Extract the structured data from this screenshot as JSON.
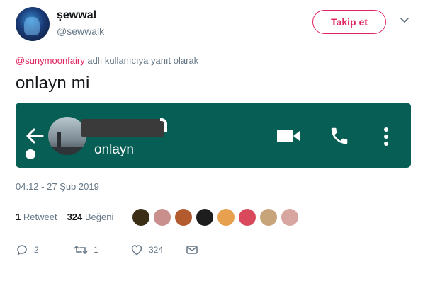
{
  "tweet": {
    "display_name": "şewwal",
    "username": "@sewwalk",
    "follow_label": "Takip et",
    "reply_mention": "@sunymoonfairy",
    "reply_suffix": " adlı kullanıcıya yanıt olarak",
    "text": "onlayn mi",
    "timestamp": "04:12 - 27 Şub 2019"
  },
  "whatsapp_header": {
    "status": "onlayn",
    "background": "#075e54",
    "icons": [
      "back-arrow-icon",
      "video-call-icon",
      "phone-icon",
      "more-vert-icon"
    ]
  },
  "stats": {
    "retweet_count": "1",
    "retweet_label": "Retweet",
    "like_count": "324",
    "like_label": "Beğeni"
  },
  "liker_avatars": [
    "#3b2f16",
    "#c98f8c",
    "#b35a2e",
    "#1d1d1d",
    "#e7a04e",
    "#d84a5b",
    "#c7a47a",
    "#d7a6a0"
  ],
  "actions": {
    "reply_count": "2",
    "retweet_count": "1",
    "like_count": "324"
  },
  "colors": {
    "accent": "#e0245e",
    "muted": "#657786",
    "whatsapp": "#075e54"
  }
}
